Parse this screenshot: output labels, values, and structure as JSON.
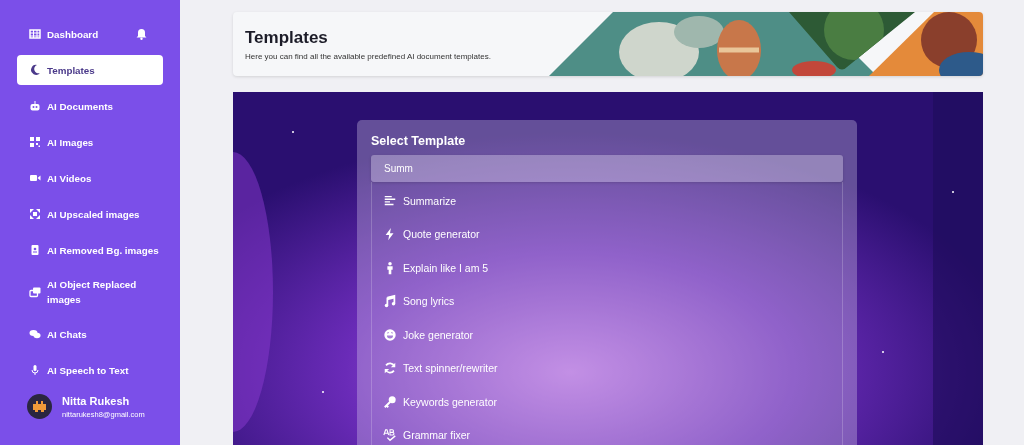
{
  "sidebar": {
    "items": [
      {
        "label": "Dashboard",
        "selected": false,
        "bell": true
      },
      {
        "label": "Templates",
        "selected": true
      },
      {
        "label": "AI Documents",
        "selected": false
      },
      {
        "label": "AI Images",
        "selected": false
      },
      {
        "label": "AI Videos",
        "selected": false
      },
      {
        "label": "AI Upscaled images",
        "selected": false
      },
      {
        "label": "AI Removed Bg. images",
        "selected": false
      },
      {
        "label": "AI Object Replaced images",
        "selected": false
      },
      {
        "label": "AI Chats",
        "selected": false
      },
      {
        "label": "AI Speech to Text",
        "selected": false
      }
    ],
    "user": {
      "name": "Nitta Rukesh",
      "email": "nittarukesh8@gmail.com"
    }
  },
  "header": {
    "title": "Templates",
    "subtitle": "Here you can find all the available predefined AI document templates."
  },
  "template_picker": {
    "title": "Select Template",
    "search": {
      "value": "Summ"
    },
    "options": [
      {
        "label": "Summarize",
        "selected": false
      },
      {
        "label": "Quote generator",
        "selected": false
      },
      {
        "label": "Explain like I am 5",
        "selected": false
      },
      {
        "label": "Song lyrics",
        "selected": false
      },
      {
        "label": "Joke generator",
        "selected": false
      },
      {
        "label": "Text spinner/rewriter",
        "selected": false
      },
      {
        "label": "Keywords generator",
        "selected": false
      },
      {
        "label": "Grammar fixer",
        "selected": false
      }
    ]
  }
}
